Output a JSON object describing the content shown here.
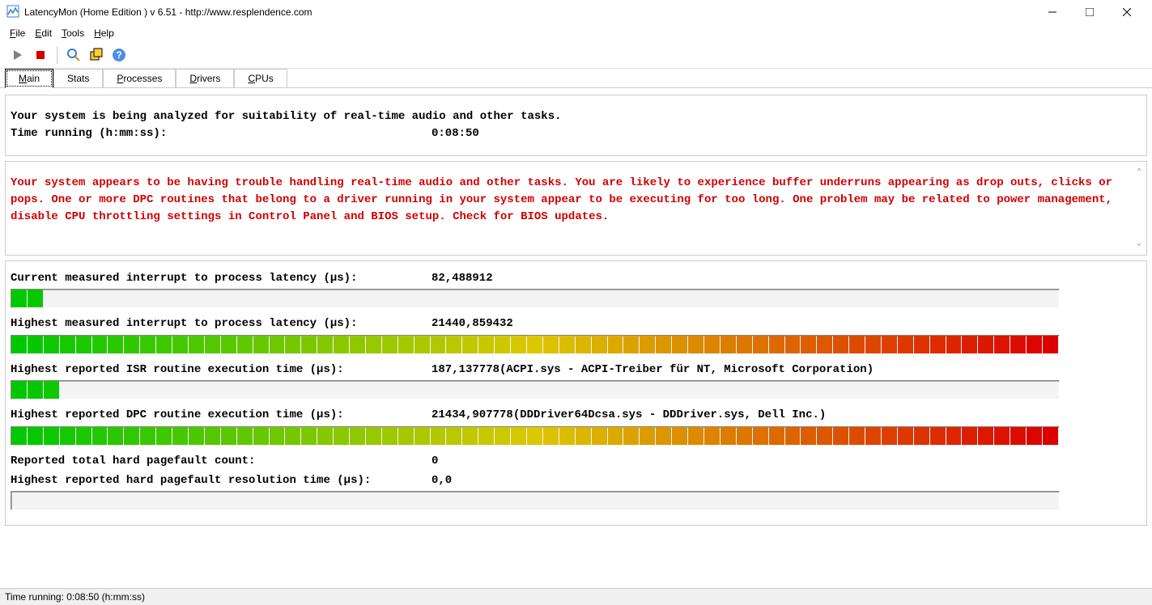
{
  "window": {
    "title": "LatencyMon  (Home Edition )  v 6.51 - http://www.resplendence.com"
  },
  "menu": {
    "file": "File",
    "edit": "Edit",
    "tools": "Tools",
    "help": "Help"
  },
  "toolbar_icons": {
    "play": "play-icon",
    "stop": "stop-icon",
    "inspect": "inspect-icon",
    "windows": "windows-icon",
    "help": "help-icon"
  },
  "tabs": {
    "main": "Main",
    "stats": "Stats",
    "processes": "Processes",
    "drivers": "Drivers",
    "cpus": "CPUs"
  },
  "summary": {
    "line1": "Your system is being analyzed for suitability of real-time audio and other tasks.",
    "time_label": "Time running (h:mm:ss):",
    "time_value": "0:08:50"
  },
  "warning": "Your system appears to be having trouble handling real-time audio and other tasks. You are likely to experience buffer underruns appearing as drop outs, clicks or pops. One or more DPC routines that belong to a driver running in your system appear to be executing for too long. One problem may be related to power management, disable CPU throttling settings in Control Panel and BIOS setup. Check for BIOS updates.",
  "metrics": {
    "current_latency": {
      "label": "Current measured interrupt to process latency (µs):",
      "value": "82,488912",
      "fill": 0.03
    },
    "highest_latency": {
      "label": "Highest measured interrupt to process latency (µs):",
      "value": "21440,859432",
      "fill": 1.0
    },
    "highest_isr": {
      "label": "Highest reported ISR routine execution time (µs):",
      "value": "187,137778",
      "extra": "(ACPI.sys - ACPI-Treiber für NT, Microsoft Corporation)",
      "fill": 0.05
    },
    "highest_dpc": {
      "label": "Highest reported DPC routine execution time (µs):",
      "value": "21434,907778",
      "extra": "(DDDriver64Dcsa.sys - DDDriver.sys, Dell Inc.)",
      "fill": 1.0
    },
    "pagefault_count": {
      "label": "Reported total hard pagefault count:",
      "value": "0"
    },
    "pagefault_time": {
      "label": "Highest reported hard pagefault resolution time (µs):",
      "value": "0,0",
      "fill": 0.0
    }
  },
  "statusbar": "Time running: 0:08:50  (h:mm:ss)",
  "chart_data": {
    "type": "bar",
    "note": "segmented gradient bars representing latency metrics; segment count ~65, color green→red by position, filled left-to-right by 'fill' fraction",
    "bars": [
      {
        "name": "current_latency",
        "fill": 0.03
      },
      {
        "name": "highest_latency",
        "fill": 1.0
      },
      {
        "name": "highest_isr",
        "fill": 0.05
      },
      {
        "name": "highest_dpc",
        "fill": 1.0
      },
      {
        "name": "pagefault_time",
        "fill": 0.0
      }
    ],
    "segments": 65
  }
}
